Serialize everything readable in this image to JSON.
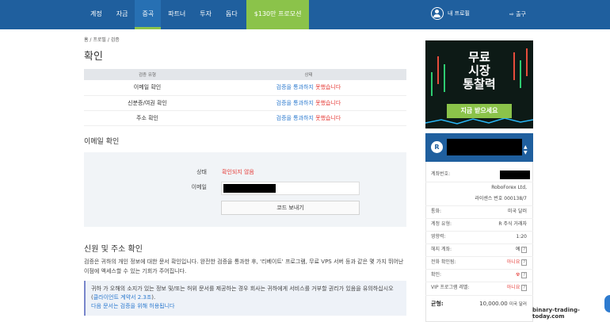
{
  "nav": {
    "items": [
      "계정",
      "자금",
      "증곡",
      "파트너",
      "투자",
      "돕다"
    ],
    "active_index": 2,
    "promo": "$130만 프로모션",
    "profile": "내 프로필",
    "logout": "출구"
  },
  "breadcrumb": "홈 / 프로필 / 검증",
  "title": "확인",
  "verification_table": {
    "headers": [
      "검증 유형",
      "상태"
    ],
    "rows": [
      {
        "type": "이메일 확인",
        "status_a": "검증을 통과하지",
        "status_b": "못했습니다"
      },
      {
        "type": "신분증/여권 확인",
        "status_a": "검증을 통과하지",
        "status_b": "못했습니다"
      },
      {
        "type": "주소 확인",
        "status_a": "검증을 통과하지",
        "status_b": "못했습니다"
      }
    ]
  },
  "email_section": {
    "title": "이메일 확인",
    "status_label": "상태",
    "status_value": "확인되지 않음",
    "email_label": "이메일",
    "send_button": "코드 보내기"
  },
  "id_section": {
    "title": "신원 및 주소 확인",
    "desc": "검증은 귀하의 개인 정보에 대한 문서 확인입니다. 완전한 검증을 통과한 후, '리베이트' 프로그램, 무료 VPS 서버 등과 같은 몇 가지 뛰어난 이점에 액세스할 수 있는 기회가 주어집니다.",
    "warning": "귀하 가 오해의 소지가 있는 정보 및/또는 허위 문서를 제공하는 경우 회사는 귀하에게 서비스를 거부할 권리가 있음을 유의하십시오 (",
    "warning_link": "클라이언트 계약서 2.3조",
    "warning_end": ").",
    "warning_line2": "다음 문서는 검증을 위해 허용됩니다"
  },
  "ad": {
    "line1": "무료",
    "line2": "시장",
    "line3": "통찰력",
    "button": "지금 받으세요"
  },
  "account": {
    "logo": "R",
    "account_no_label": "계좌번호:",
    "broker": "RoboForex Ltd,",
    "license": "라이센스 번호 000138/7",
    "currency_label": "통화:",
    "currency_value": "미국 달러",
    "type_label": "계정 유형:",
    "type_value": "R 주식 거래자",
    "leverage_label": "영향력:",
    "leverage_value": "1:20",
    "hedge_label": "헤지 계좌:",
    "hedge_value": "예",
    "phone_label": "전화 확인됨:",
    "phone_value": "아니요",
    "confirm_label": "확인:",
    "vip_label": "VIP 프로그램 레벨:",
    "vip_value": "아니요",
    "balance_label": "균형:",
    "balance_value": "10,000.00",
    "balance_currency": "미국 달러",
    "help": "?"
  },
  "watermark": "binary-trading-today.com",
  "colors": {
    "nav_bg": "#1f5f9e",
    "accent_green": "#8bc34a",
    "error_red": "#e53935",
    "link_blue": "#2e7bcf"
  }
}
